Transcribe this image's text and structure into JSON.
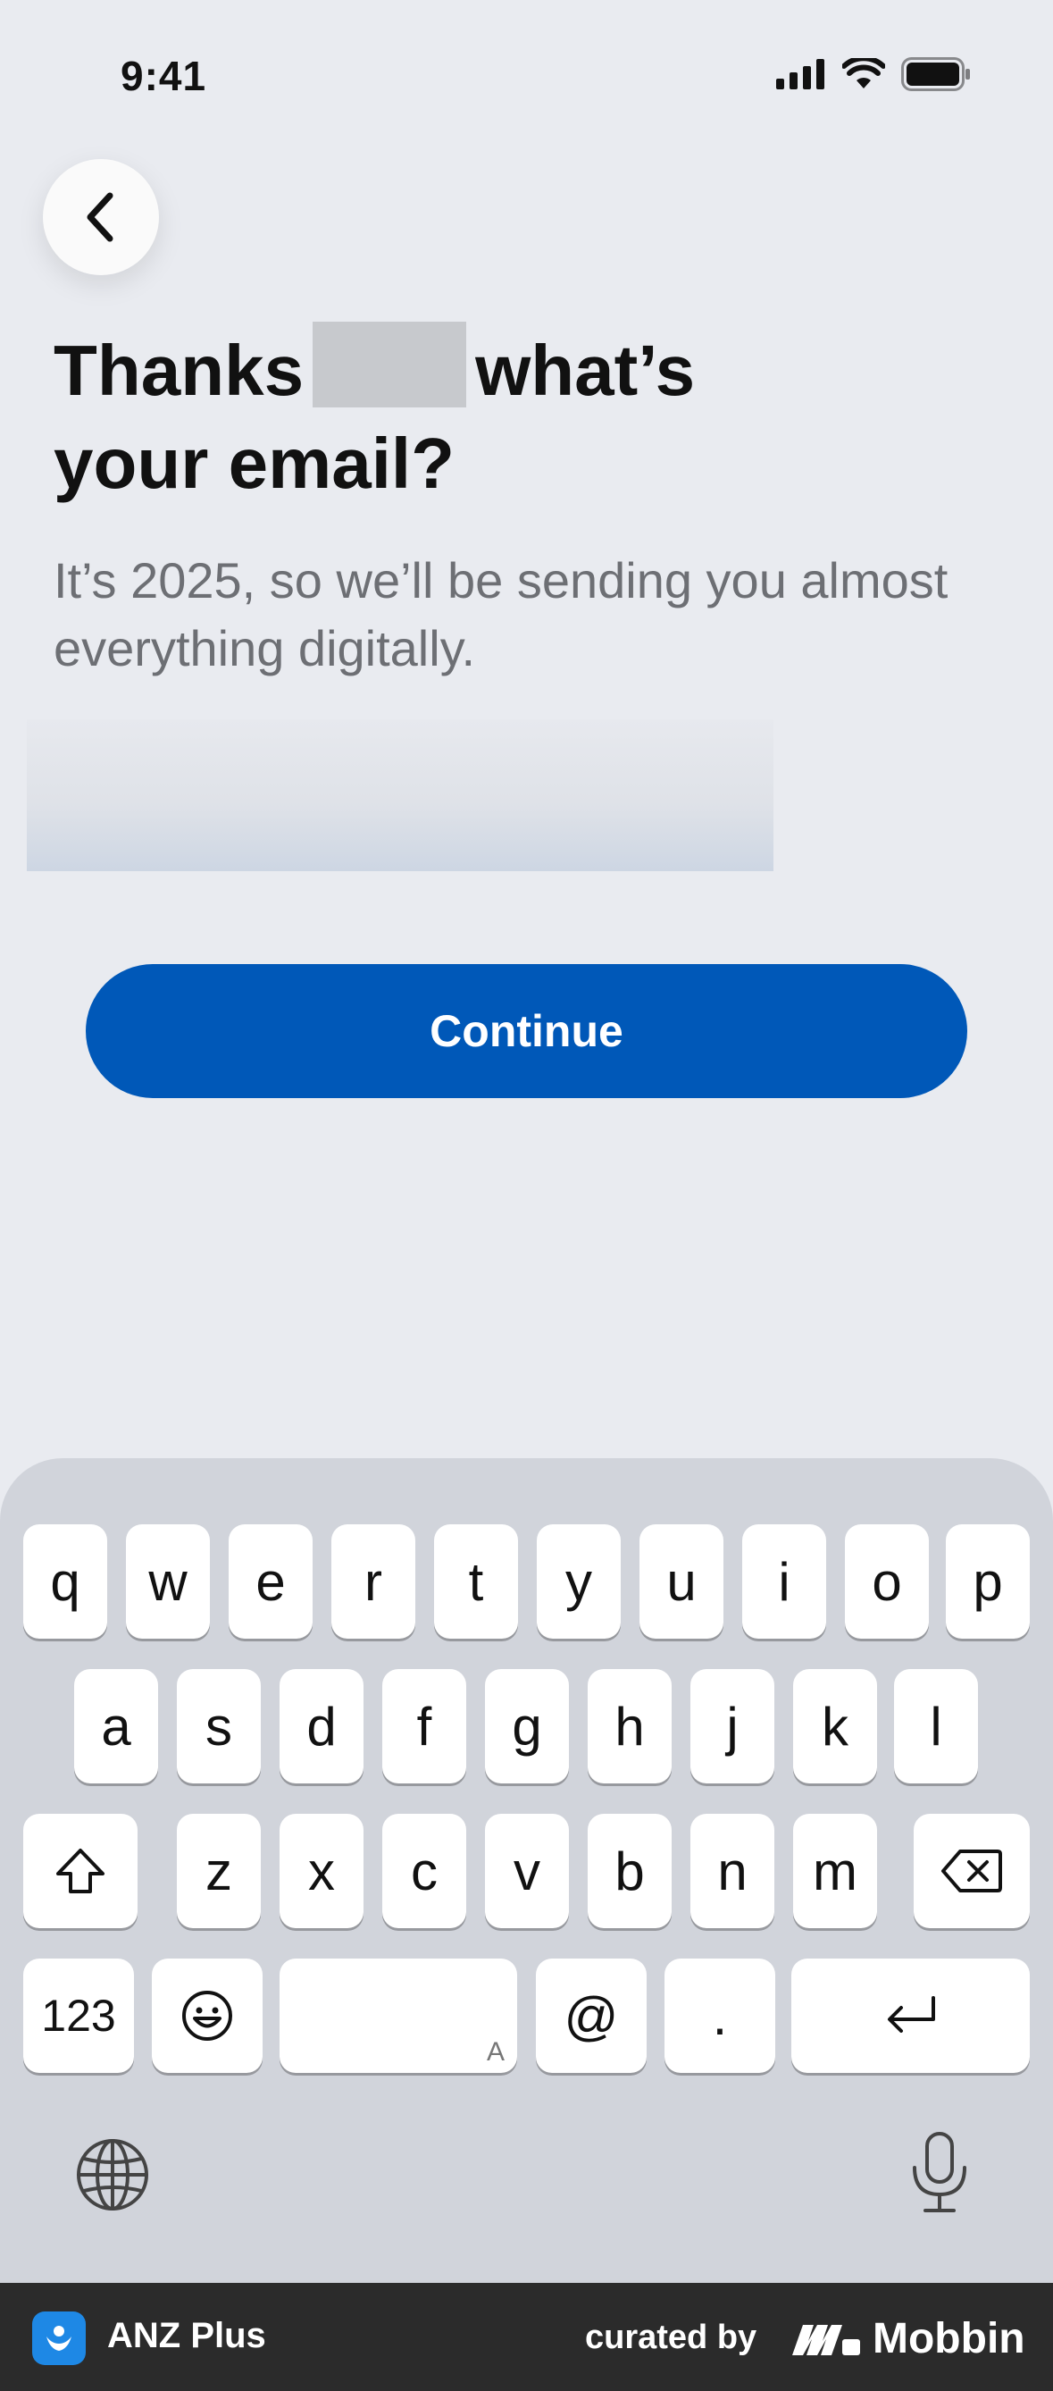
{
  "status_bar": {
    "time": "9:41"
  },
  "header": {
    "title_part1": "Thanks",
    "title_part2": "what’s",
    "title_line2": "your email?",
    "subtitle": "It’s 2025, so we’ll be sending you almost everything digitally."
  },
  "form": {
    "email_value": "",
    "continue_label": "Continue"
  },
  "keyboard": {
    "row1": [
      "q",
      "w",
      "e",
      "r",
      "t",
      "y",
      "u",
      "i",
      "o",
      "p"
    ],
    "row2": [
      "a",
      "s",
      "d",
      "f",
      "g",
      "h",
      "j",
      "k",
      "l"
    ],
    "row3": [
      "z",
      "x",
      "c",
      "v",
      "b",
      "n",
      "m"
    ],
    "numbers_label": "123",
    "space_hint": "A",
    "at_label": "@",
    "dot_label": "."
  },
  "footer": {
    "app_name": "ANZ Plus",
    "curated_by": "curated by",
    "brand": "Mobbin"
  },
  "colors": {
    "primary": "#0058b8",
    "background": "#e9ebf0",
    "keyboard": "#d1d4db",
    "footer": "#2b2b2b"
  }
}
